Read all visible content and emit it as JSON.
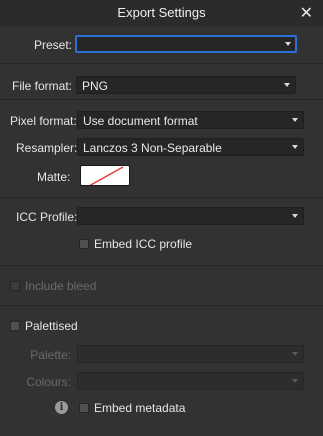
{
  "window": {
    "title": "Export Settings"
  },
  "preset": {
    "label": "Preset:",
    "value": ""
  },
  "file_format": {
    "label": "File format:",
    "value": "PNG"
  },
  "pixel_format": {
    "label": "Pixel format:",
    "value": "Use document format"
  },
  "resampler": {
    "label": "Resampler:",
    "value": "Lanczos 3 Non-Separable"
  },
  "matte": {
    "label": "Matte:",
    "swatch_color": "#ffffff",
    "slash_color": "#e53935"
  },
  "icc_profile": {
    "label": "ICC Profile:",
    "value": ""
  },
  "embed_icc": {
    "label": "Embed ICC profile",
    "checked": false
  },
  "include_bleed": {
    "label": "Include bleed",
    "checked": false,
    "enabled": false
  },
  "palettised": {
    "label": "Palettised",
    "checked": false
  },
  "palette": {
    "label": "Palette:",
    "value": "",
    "enabled": false
  },
  "colours": {
    "label": "Colours:",
    "value": "",
    "enabled": false
  },
  "info_icon": {
    "glyph": "i"
  },
  "embed_metadata": {
    "label": "Embed metadata",
    "checked": false
  }
}
